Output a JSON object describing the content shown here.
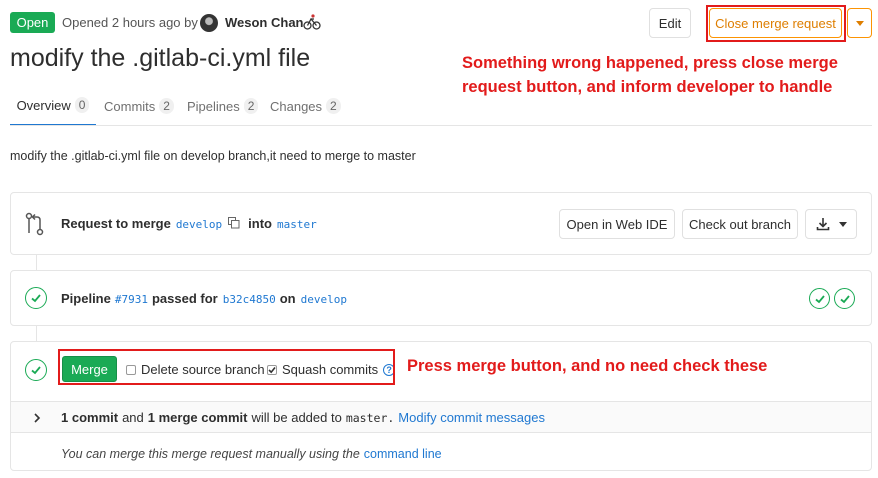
{
  "header": {
    "status_badge": "Open",
    "opened_text": "Opened 2 hours ago by",
    "author": "Weson Chan",
    "edit_label": "Edit",
    "close_label": "Close merge request",
    "title": "modify the .gitlab-ci.yml file"
  },
  "tabs": [
    {
      "label": "Overview",
      "count": "0"
    },
    {
      "label": "Commits",
      "count": "2"
    },
    {
      "label": "Pipelines",
      "count": "2"
    },
    {
      "label": "Changes",
      "count": "2"
    }
  ],
  "description": "modify the .gitlab-ci.yml file on develop branch,it need to merge to master",
  "merge_request": {
    "request_to_merge": "Request to merge",
    "source_branch": "develop",
    "into": "into",
    "target_branch": "master",
    "open_web_ide": "Open in Web IDE",
    "check_out_branch": "Check out branch"
  },
  "pipeline": {
    "label": "Pipeline",
    "id": "#7931",
    "passed_for": "passed for",
    "commit": "b32c4850",
    "on": "on",
    "branch": "develop"
  },
  "merge_widget": {
    "merge_label": "Merge",
    "delete_source_label": "Delete source branch",
    "delete_source_checked": false,
    "squash_label": "Squash commits",
    "squash_checked": true,
    "commits_count": "1 commit",
    "and": "and",
    "merge_commit": "1 merge commit",
    "will_be_added": "will be added to",
    "target": "master.",
    "modify_link": "Modify commit messages",
    "manual_text": "You can merge this merge request manually using the",
    "command_line_link": "command line"
  },
  "annotations": {
    "top_right_line1": "Something wrong happened, press close merge",
    "top_right_line2": "request button, and inform developer to handle",
    "merge_note": "Press merge button, and no need check these"
  },
  "colors": {
    "green": "#1aaa55",
    "link_blue": "#1f78d1",
    "close_orange": "#fc9403",
    "annotation_red": "#e21b1b"
  }
}
